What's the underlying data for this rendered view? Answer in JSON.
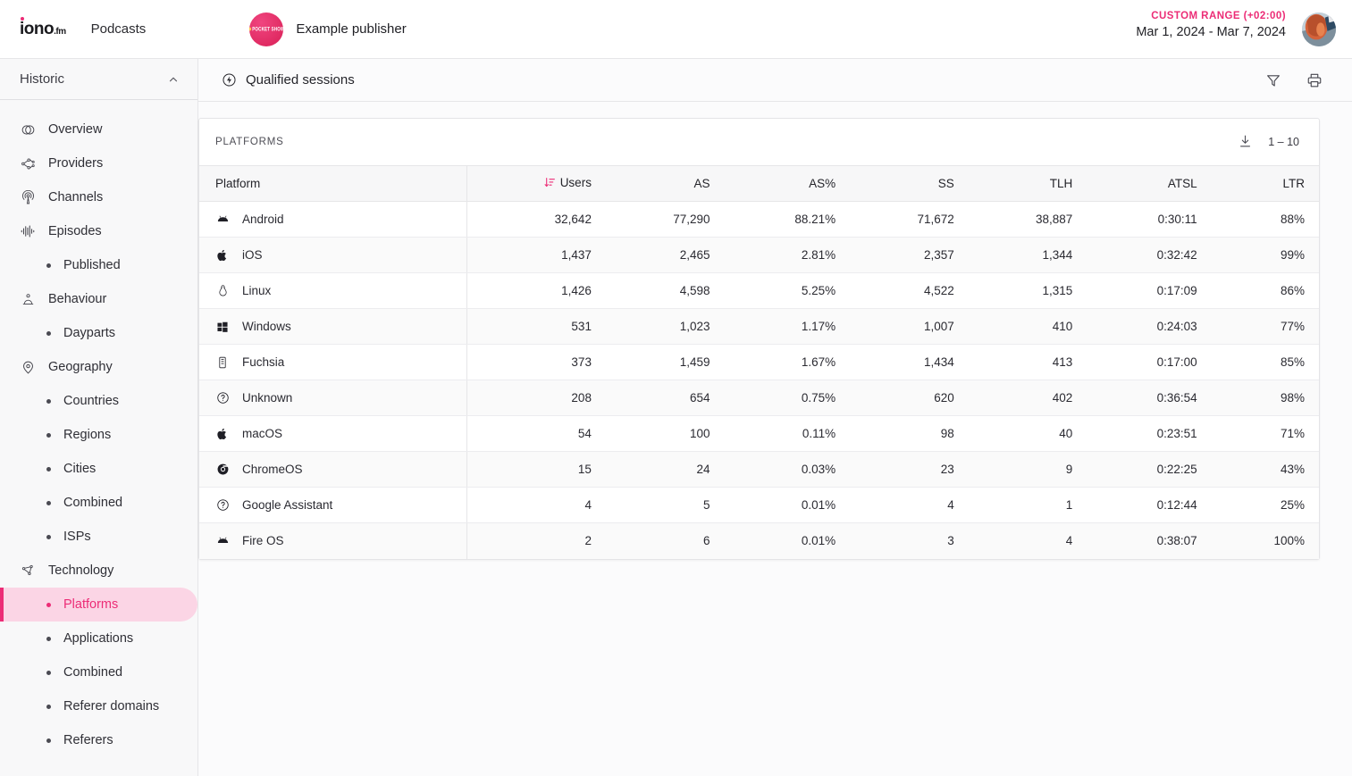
{
  "topbar": {
    "logo_text": "iono",
    "logo_suffix": ".fm",
    "section_label": "Podcasts",
    "publisher_name": "Example publisher",
    "publisher_avatar_text": "POCKET SHOW",
    "date_range_label": "CUSTOM RANGE (+02:00)",
    "date_range_value": "Mar 1, 2024 - Mar 7, 2024"
  },
  "sidebar": {
    "header_title": "Historic",
    "collapse_icon": "chevron-up-icon",
    "items": [
      {
        "label": "Overview",
        "icon": "overview-icon",
        "type": "top",
        "active": false
      },
      {
        "label": "Providers",
        "icon": "providers-icon",
        "type": "top",
        "active": false
      },
      {
        "label": "Channels",
        "icon": "channels-icon",
        "type": "top",
        "active": false
      },
      {
        "label": "Episodes",
        "icon": "episodes-icon",
        "type": "top",
        "active": false
      },
      {
        "label": "Published",
        "icon": "bullet",
        "type": "sub",
        "active": false
      },
      {
        "label": "Behaviour",
        "icon": "behaviour-icon",
        "type": "top",
        "active": false
      },
      {
        "label": "Dayparts",
        "icon": "bullet",
        "type": "sub",
        "active": false
      },
      {
        "label": "Geography",
        "icon": "geography-icon",
        "type": "top",
        "active": false
      },
      {
        "label": "Countries",
        "icon": "bullet",
        "type": "sub",
        "active": false
      },
      {
        "label": "Regions",
        "icon": "bullet",
        "type": "sub",
        "active": false
      },
      {
        "label": "Cities",
        "icon": "bullet",
        "type": "sub",
        "active": false
      },
      {
        "label": "Combined",
        "icon": "bullet",
        "type": "sub",
        "active": false
      },
      {
        "label": "ISPs",
        "icon": "bullet",
        "type": "sub",
        "active": false
      },
      {
        "label": "Technology",
        "icon": "technology-icon",
        "type": "top",
        "active": false
      },
      {
        "label": "Platforms",
        "icon": "bullet",
        "type": "sub",
        "active": true
      },
      {
        "label": "Applications",
        "icon": "bullet",
        "type": "sub",
        "active": false
      },
      {
        "label": "Combined",
        "icon": "bullet",
        "type": "sub",
        "active": false
      },
      {
        "label": "Referer domains",
        "icon": "bullet",
        "type": "sub",
        "active": false
      },
      {
        "label": "Referers",
        "icon": "bullet",
        "type": "sub",
        "active": false
      }
    ]
  },
  "main": {
    "header_title": "Qualified sessions",
    "header_icon": "lightning-circle-icon",
    "filter_icon": "filter-icon",
    "print_icon": "print-icon"
  },
  "card": {
    "title": "PLATFORMS",
    "download_icon": "download-icon",
    "pager": "1 – 10"
  },
  "table": {
    "columns": [
      {
        "key": "platform",
        "label": "Platform",
        "align": "left",
        "sorted": false
      },
      {
        "key": "users",
        "label": "Users",
        "align": "right",
        "sorted": true
      },
      {
        "key": "as",
        "label": "AS",
        "align": "right",
        "sorted": false
      },
      {
        "key": "aspct",
        "label": "AS%",
        "align": "right",
        "sorted": false
      },
      {
        "key": "ss",
        "label": "SS",
        "align": "right",
        "sorted": false
      },
      {
        "key": "tlh",
        "label": "TLH",
        "align": "right",
        "sorted": false
      },
      {
        "key": "atsl",
        "label": "ATSL",
        "align": "right",
        "sorted": false
      },
      {
        "key": "ltr",
        "label": "LTR",
        "align": "right",
        "sorted": false
      }
    ],
    "sort_icon": "sort-descending-icon",
    "rows": [
      {
        "icon": "android-icon",
        "platform": "Android",
        "users": "32,642",
        "as": "77,290",
        "aspct": "88.21%",
        "ss": "71,672",
        "tlh": "38,887",
        "atsl": "0:30:11",
        "ltr": "88%"
      },
      {
        "icon": "apple-icon",
        "platform": "iOS",
        "users": "1,437",
        "as": "2,465",
        "aspct": "2.81%",
        "ss": "2,357",
        "tlh": "1,344",
        "atsl": "0:32:42",
        "ltr": "99%"
      },
      {
        "icon": "linux-icon",
        "platform": "Linux",
        "users": "1,426",
        "as": "4,598",
        "aspct": "5.25%",
        "ss": "4,522",
        "tlh": "1,315",
        "atsl": "0:17:09",
        "ltr": "86%"
      },
      {
        "icon": "windows-icon",
        "platform": "Windows",
        "users": "531",
        "as": "1,023",
        "aspct": "1.17%",
        "ss": "1,007",
        "tlh": "410",
        "atsl": "0:24:03",
        "ltr": "77%"
      },
      {
        "icon": "fuchsia-icon",
        "platform": "Fuchsia",
        "users": "373",
        "as": "1,459",
        "aspct": "1.67%",
        "ss": "1,434",
        "tlh": "413",
        "atsl": "0:17:00",
        "ltr": "85%"
      },
      {
        "icon": "unknown-icon",
        "platform": "Unknown",
        "users": "208",
        "as": "654",
        "aspct": "0.75%",
        "ss": "620",
        "tlh": "402",
        "atsl": "0:36:54",
        "ltr": "98%"
      },
      {
        "icon": "apple-icon",
        "platform": "macOS",
        "users": "54",
        "as": "100",
        "aspct": "0.11%",
        "ss": "98",
        "tlh": "40",
        "atsl": "0:23:51",
        "ltr": "71%"
      },
      {
        "icon": "chrome-icon",
        "platform": "ChromeOS",
        "users": "15",
        "as": "24",
        "aspct": "0.03%",
        "ss": "23",
        "tlh": "9",
        "atsl": "0:22:25",
        "ltr": "43%"
      },
      {
        "icon": "unknown-icon",
        "platform": "Google Assistant",
        "users": "4",
        "as": "5",
        "aspct": "0.01%",
        "ss": "4",
        "tlh": "1",
        "atsl": "0:12:44",
        "ltr": "25%"
      },
      {
        "icon": "android-icon",
        "platform": "Fire OS",
        "users": "2",
        "as": "6",
        "aspct": "0.01%",
        "ss": "3",
        "tlh": "4",
        "atsl": "0:38:07",
        "ltr": "100%"
      }
    ]
  },
  "colors": {
    "accent_pink": "#ec2c76",
    "accent_pink_light": "#fbd5e5",
    "sidebar_bg": "#f8f8f9",
    "main_bg": "#fbfbfc",
    "border": "#e6e6e8"
  }
}
